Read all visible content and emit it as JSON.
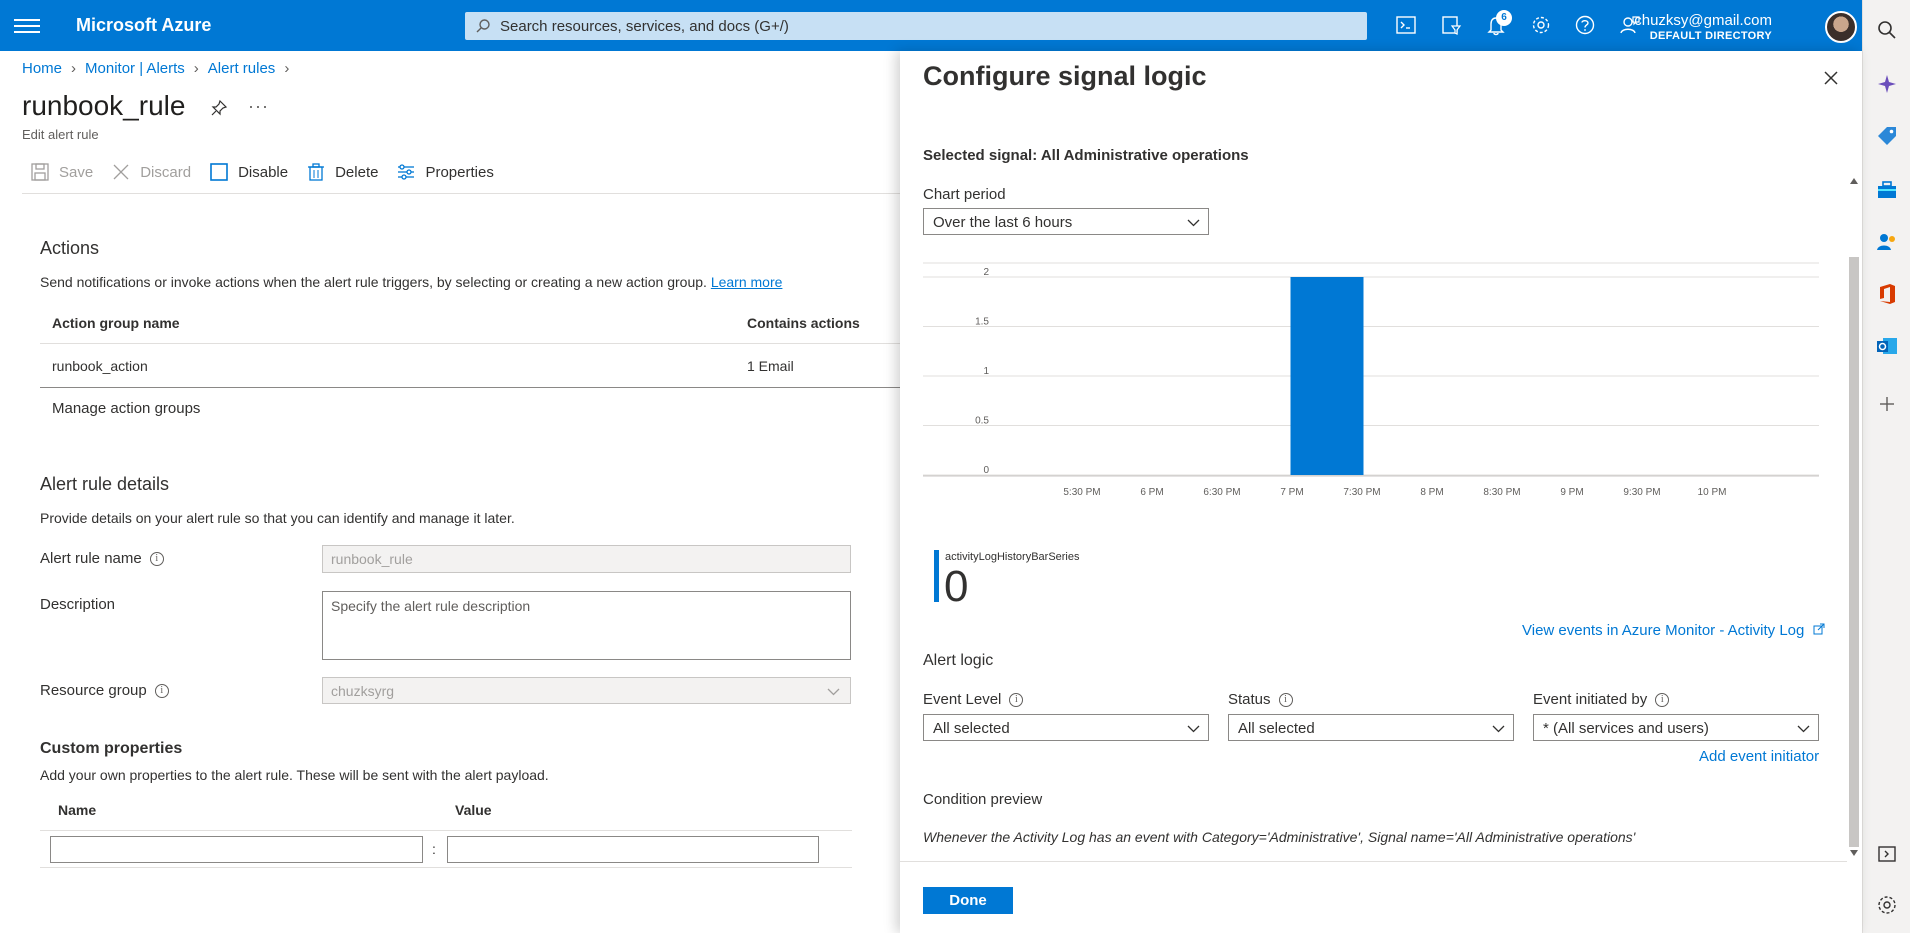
{
  "topbar": {
    "brand": "Microsoft Azure",
    "search_placeholder": "Search resources, services, and docs (G+/)",
    "notification_count": "6",
    "account_email": "chuzksy@gmail.com",
    "account_directory": "DEFAULT DIRECTORY",
    "icons": [
      "cloud-shell-icon",
      "directory-filter-icon",
      "bell-icon",
      "gear-icon",
      "help-icon",
      "feedback-icon"
    ]
  },
  "breadcrumb": {
    "items": [
      "Home",
      "Monitor | Alerts",
      "Alert rules"
    ]
  },
  "page": {
    "title": "runbook_rule",
    "subtitle": "Edit alert rule"
  },
  "commands": {
    "save": "Save",
    "discard": "Discard",
    "disable": "Disable",
    "delete": "Delete",
    "properties": "Properties"
  },
  "actions": {
    "heading": "Actions",
    "description": "Send notifications or invoke actions when the alert rule triggers, by selecting or creating a new action group.",
    "learn_more": "Learn more",
    "columns": [
      "Action group name",
      "Contains actions"
    ],
    "rows": [
      {
        "name": "runbook_action",
        "contains": "1 Email"
      }
    ],
    "manage_link": "Manage action groups"
  },
  "details": {
    "heading": "Alert rule details",
    "description": "Provide details on your alert rule so that you can identify and manage it later.",
    "rule_name_label": "Alert rule name",
    "rule_name_value": "runbook_rule",
    "description_label": "Description",
    "description_placeholder": "Specify the alert rule description",
    "resource_group_label": "Resource group",
    "resource_group_value": "chuzksyrg"
  },
  "custom": {
    "heading": "Custom properties",
    "description": "Add your own properties to the alert rule. These will be sent with the alert payload.",
    "columns": [
      "Name",
      "Value"
    ],
    "separator": ":"
  },
  "panel": {
    "title": "Configure signal logic",
    "selected_signal": "Selected signal: All Administrative operations",
    "chart_period_label": "Chart period",
    "chart_period_value": "Over the last 6 hours",
    "legend_series": "activityLogHistoryBarSeries",
    "legend_value": "0",
    "view_events": "View events in Azure Monitor - Activity Log",
    "alert_logic_heading": "Alert logic",
    "event_level_label": "Event Level",
    "event_level_value": "All selected",
    "status_label": "Status",
    "status_value": "All selected",
    "initiated_label": "Event initiated by",
    "initiated_value": "* (All services and users)",
    "add_initiator": "Add event initiator",
    "condition_heading": "Condition preview",
    "condition_text": "Whenever the Activity Log has an event with Category='Administrative', Signal name='All Administrative operations'",
    "done": "Done"
  },
  "chart_data": {
    "type": "bar",
    "categories": [
      "5:30 PM",
      "6 PM",
      "6:30 PM",
      "7 PM",
      "7:30 PM",
      "8 PM",
      "8:30 PM",
      "9 PM",
      "9:30 PM",
      "10 PM"
    ],
    "x_ticks": [
      "5:30 PM",
      "6 PM",
      "6:30 PM",
      "7 PM",
      "7:30 PM",
      "8 PM",
      "8:30 PM",
      "9 PM",
      "9:30 PM",
      "10 PM"
    ],
    "y_ticks": [
      "0",
      "0.5",
      "1",
      "1.5",
      "2"
    ],
    "ylim": [
      0,
      2
    ],
    "series": [
      {
        "name": "activityLogHistoryBarSeries",
        "bars": [
          {
            "x": "7:15 PM",
            "value": 2
          }
        ]
      }
    ],
    "bar_color": "#0078d4",
    "grid": true
  },
  "colors": {
    "accent": "#0078d4",
    "topbar": "#0078d4"
  }
}
